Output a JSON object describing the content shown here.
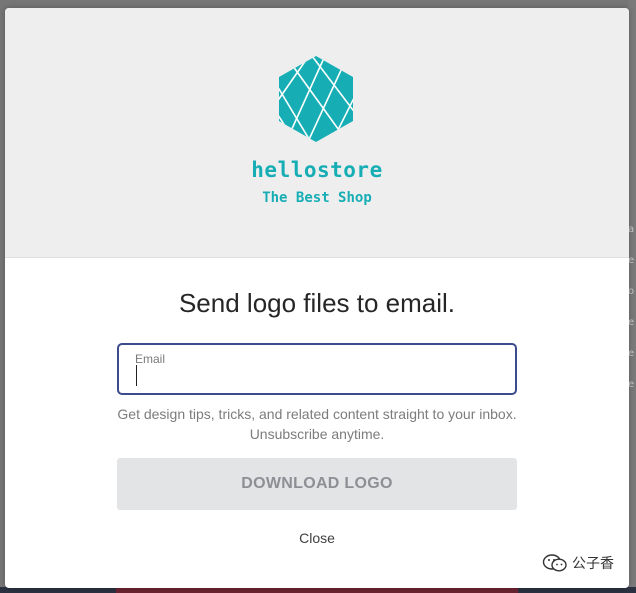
{
  "modal": {
    "brand": {
      "name": "hellostore",
      "tagline": "The Best Shop",
      "accent_color": "#16aeb4",
      "icon": "hexagon-logo-icon"
    },
    "heading": "Send logo files to email.",
    "email_field": {
      "label": "Email",
      "value": "",
      "placeholder": ""
    },
    "disclaimer": "Get design tips, tricks, and related content straight to your inbox. Unsubscribe anytime.",
    "download_button": "DOWNLOAD LOGO",
    "close_link": "Close"
  },
  "backdrop": {
    "side_fragments": [
      "a",
      "e",
      "o",
      "e",
      "e",
      "e"
    ]
  },
  "watermark": {
    "icon": "wechat-logo-icon",
    "text": "公子香"
  }
}
